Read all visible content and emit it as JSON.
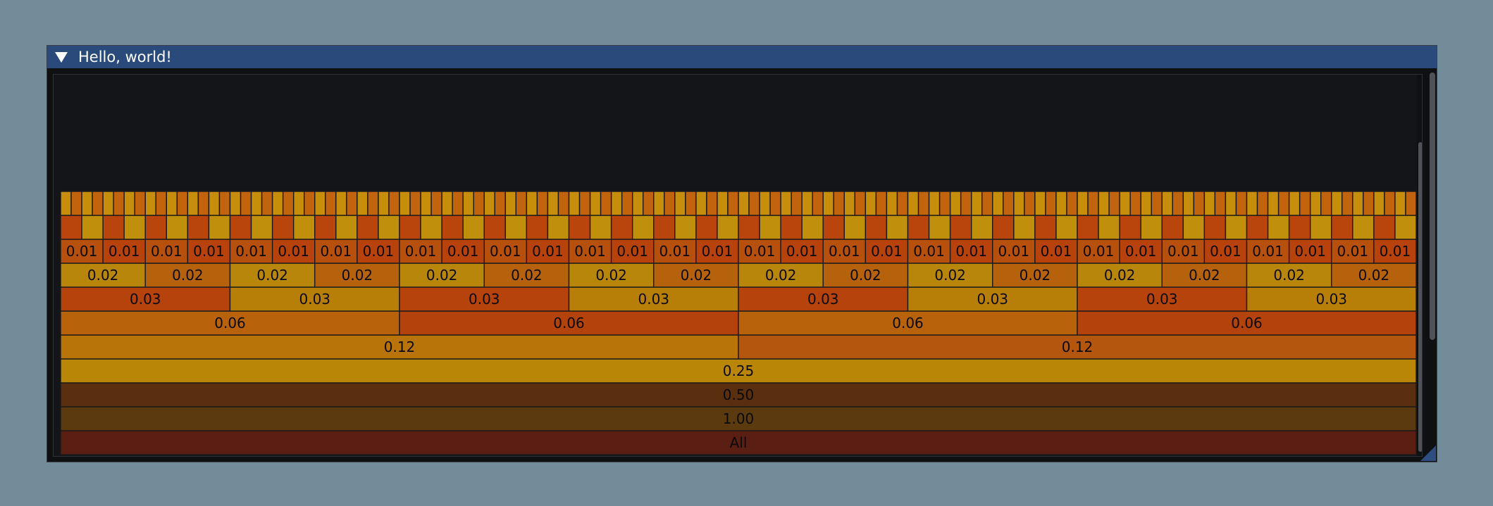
{
  "window": {
    "title": "Hello, world!",
    "collapse_icon": "triangle-down-icon"
  },
  "flame_graph": {
    "root_label": "All",
    "levels": [
      {
        "depth": 0,
        "label": "All",
        "count": 1,
        "color": "#5a1f12"
      },
      {
        "depth": 1,
        "label": "1.00",
        "count": 1,
        "color": "#5b3a10"
      },
      {
        "depth": 2,
        "label": "0.50",
        "count": 1,
        "color": "#5a2f10"
      },
      {
        "depth": 3,
        "label": "0.25",
        "count": 1,
        "colors": [
          "#b98608"
        ]
      },
      {
        "depth": 4,
        "label": "0.12",
        "count": 2,
        "colors": [
          "#b87408",
          "#b5560f"
        ]
      },
      {
        "depth": 5,
        "label": "0.06",
        "count": 4,
        "colors": [
          "#b8620b",
          "#b4420c"
        ]
      },
      {
        "depth": 6,
        "label": "0.03",
        "count": 8,
        "colors": [
          "#b5430b",
          "#b87f08"
        ]
      },
      {
        "depth": 7,
        "label": "0.02",
        "count": 16,
        "colors": [
          "#b8860b",
          "#b6620d"
        ]
      },
      {
        "depth": 8,
        "label": "0.01",
        "count": 32,
        "colors": [
          "#b7500d",
          "#b8420b"
        ]
      },
      {
        "depth": 9,
        "label": "",
        "count": 64,
        "colors": [
          "#b9450c",
          "#c08f0b"
        ]
      },
      {
        "depth": 10,
        "label": "",
        "count": 128,
        "colors": [
          "#c78e0c",
          "#c2640e"
        ]
      }
    ]
  }
}
